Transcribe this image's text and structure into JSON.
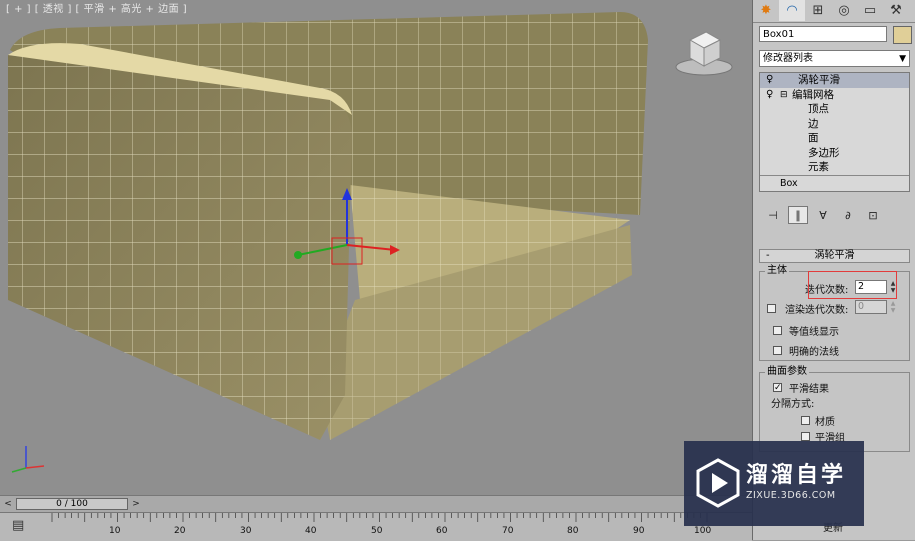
{
  "viewport": {
    "label": "[ + ] [ 透视 ] [ 平滑 + 高光 + 边面 ]"
  },
  "panel": {
    "tabs": [
      "create-icon",
      "modify-icon",
      "hierarchy-icon",
      "motion-icon",
      "display-icon",
      "utilities-icon"
    ],
    "object_name": "Box01",
    "object_color": "#e0cf98",
    "modifier_list": "修改器列表",
    "stack": {
      "turbosmooth": "涡轮平滑",
      "edit_mesh": "编辑网格",
      "sub": [
        "顶点",
        "边",
        "面",
        "多边形",
        "元素"
      ],
      "base": "Box"
    },
    "rollout_title": "涡轮平滑",
    "main_group": "主体",
    "iterations_label": "迭代次数:",
    "iterations_value": "2",
    "render_iters_label": "渲染迭代次数:",
    "render_iters_value": "0",
    "isoline_label": "等值线显示",
    "explicit_normals_label": "明确的法线",
    "surface_group": "曲面参数",
    "smooth_result_label": "平滑结果",
    "smooth_result_checked": true,
    "separate_by_label": "分隔方式:",
    "materials_label": "材质",
    "smoothing_groups_label": "平滑组",
    "update_label": "更新"
  },
  "timeline": {
    "slider_label": "0 / 100",
    "prev": "<",
    "next": ">",
    "ticks": [
      "10",
      "20",
      "30",
      "40",
      "50",
      "60",
      "70",
      "80",
      "90",
      "100"
    ]
  },
  "watermark": {
    "title": "溜溜自学",
    "url": "ZIXUE.3D66.COM"
  },
  "colors": {
    "sofa": "#c6bb86",
    "wire": "#f2edd0",
    "highlight": "#e23b3b"
  }
}
